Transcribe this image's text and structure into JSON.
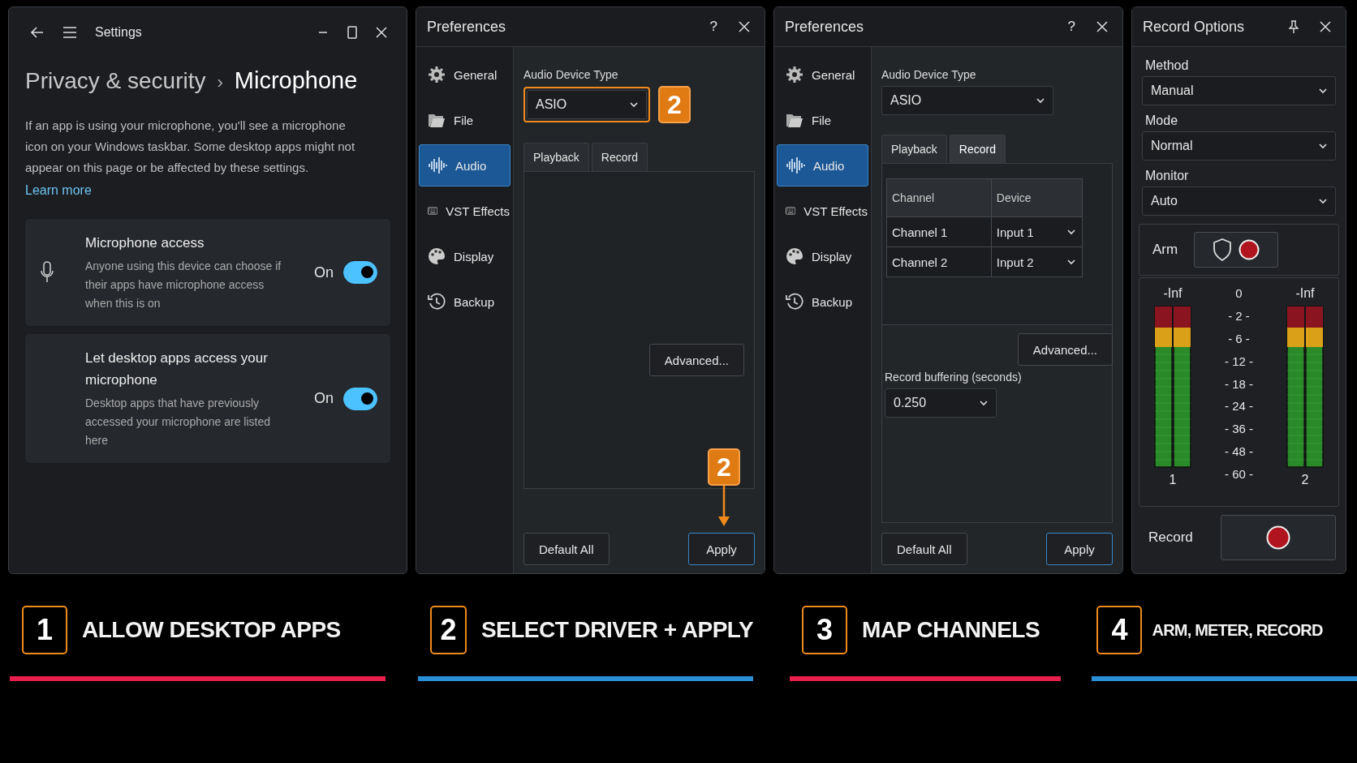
{
  "settings_window": {
    "title": "Settings",
    "breadcrumb_parent": "Privacy & security",
    "breadcrumb_separator": "›",
    "page_title": "Microphone",
    "description": "If an app is using your microphone, you'll see a microphone icon on your Windows taskbar. Some desktop apps might not appear on this page or be affected by these settings.",
    "link": "Learn more",
    "toggles": [
      {
        "kind": "microphone",
        "title": "Microphone access",
        "description": "Anyone using this device can choose if their apps have microphone access when this is on",
        "state_label": "On",
        "on": true
      },
      {
        "kind": "plain",
        "title": "Let desktop apps access your microphone",
        "description": "Desktop apps that have previously accessed your microphone are listed here",
        "state_label": "On",
        "on": true
      }
    ]
  },
  "preferences_windows": [
    {
      "title": "Preferences",
      "help": "?",
      "nav": [
        {
          "label": "General",
          "selected": false
        },
        {
          "label": "File",
          "selected": false
        },
        {
          "label": "Audio",
          "selected": true
        },
        {
          "label": "VST Effects",
          "selected": false
        },
        {
          "label": "Display",
          "selected": false
        },
        {
          "label": "Backup",
          "selected": false
        }
      ],
      "device_type_label": "Audio Device Type",
      "device_type_value": "ASIO",
      "device_highlighted": true,
      "device_callout": "2",
      "tabs": [
        {
          "label": "Playback",
          "selected": false
        },
        {
          "label": "Record",
          "selected": false
        }
      ],
      "advanced": "Advanced...",
      "default_all": "Default All",
      "apply": "Apply",
      "apply_callout": "2"
    },
    {
      "title": "Preferences",
      "help": "?",
      "nav": [
        {
          "label": "General",
          "selected": false
        },
        {
          "label": "File",
          "selected": false
        },
        {
          "label": "Audio",
          "selected": true
        },
        {
          "label": "VST Effects",
          "selected": false
        },
        {
          "label": "Display",
          "selected": false
        },
        {
          "label": "Backup",
          "selected": false
        }
      ],
      "device_type_label": "Audio Device Type",
      "device_type_value": "ASIO",
      "device_highlighted": false,
      "tabs": [
        {
          "label": "Playback",
          "selected": false
        },
        {
          "label": "Record",
          "selected": true
        }
      ],
      "mapping": {
        "columns": [
          "Channel",
          "Device"
        ],
        "rows": [
          {
            "channel": "Channel 1",
            "device": "Input 1"
          },
          {
            "channel": "Channel 2",
            "device": "Input 2"
          }
        ]
      },
      "advanced": "Advanced...",
      "buffering_label": "Record buffering (seconds)",
      "buffering_value": "0.250",
      "default_all": "Default All",
      "apply": "Apply"
    }
  ],
  "record_options": {
    "title": "Record Options",
    "fields": [
      {
        "label": "Method",
        "value": "Manual"
      },
      {
        "label": "Mode",
        "value": "Normal"
      },
      {
        "label": "Monitor",
        "value": "Auto"
      }
    ],
    "arm_label": "Arm",
    "meters": [
      {
        "reading": "-Inf",
        "number": "1"
      },
      {
        "reading": "-Inf",
        "number": "2"
      }
    ],
    "scale": [
      "0",
      "- 2 -",
      "- 6 -",
      "- 12 -",
      "- 18 -",
      "- 24 -",
      "- 36 -",
      "- 48 -",
      "- 60 -"
    ],
    "record_label": "Record"
  },
  "steps": [
    {
      "number": "1",
      "text": "ALLOW DESKTOP APPS",
      "color": "#e8204e"
    },
    {
      "number": "2",
      "text": "SELECT DRIVER + APPLY",
      "color": "#2a8fd6"
    },
    {
      "number": "3",
      "text": "MAP CHANNELS",
      "color": "#e8204e"
    },
    {
      "number": "4",
      "text": "ARM, METER, RECORD",
      "color": "#2a8fd6"
    }
  ]
}
